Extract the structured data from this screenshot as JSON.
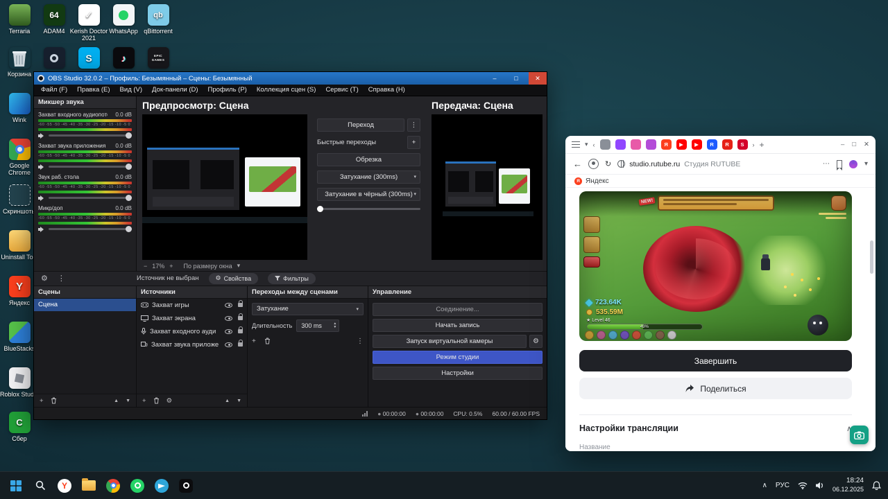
{
  "desktop": {
    "icons": [
      {
        "label": "Terraria",
        "glyph": ""
      },
      {
        "label": "ADAM4",
        "glyph": "64"
      },
      {
        "label": "Kerish Doctor 2021",
        "glyph": "✓"
      },
      {
        "label": "WhatsApp",
        "glyph": ""
      },
      {
        "label": "qBittorrent",
        "glyph": "qb"
      },
      {
        "label": "Корзина",
        "glyph": ""
      },
      {
        "label": "Steam",
        "glyph": ""
      },
      {
        "label": "Skype",
        "glyph": "S"
      },
      {
        "label": "TikTok",
        "glyph": "♪"
      },
      {
        "label": "Epic Games",
        "glyph": "EPIC GAMES"
      },
      {
        "label": "Wink",
        "glyph": ""
      },
      {
        "label": "Google Chrome",
        "glyph": ""
      },
      {
        "label": "Скриншоты",
        "glyph": ""
      },
      {
        "label": "Uninstall Tool",
        "glyph": ""
      },
      {
        "label": "Яндекс",
        "glyph": "Y"
      },
      {
        "label": "BlueStacks",
        "glyph": ""
      },
      {
        "label": "Roblox Studio",
        "glyph": ""
      },
      {
        "label": "Сбер",
        "glyph": "С"
      }
    ]
  },
  "obs": {
    "title": "OBS Studio 32.0.2 – Профиль: Безымянный – Сцены: Безымянный",
    "menu": [
      "Файл (F)",
      "Правка (E)",
      "Вид (V)",
      "Док-панели (D)",
      "Профиль (P)",
      "Коллекция сцен (S)",
      "Сервис (T)",
      "Справка (H)"
    ],
    "mixer": {
      "title": "Микшер звука",
      "scale": "-60 -55 -50 -45 -40 -35 -30 -25 -20 -15 -10 -5 0",
      "channels": [
        {
          "name": "Захват входного аудиопотока",
          "db": "0.0 dB"
        },
        {
          "name": "Захват звука приложения (БЕТА)",
          "db": "0.0 dB"
        },
        {
          "name": "Звук раб. стола",
          "db": "0.0 dB"
        },
        {
          "name": "Микр/доп",
          "db": "0.0 dB"
        }
      ]
    },
    "preview": {
      "label": "Предпросмотр: Сцена",
      "zoom": "17%",
      "fit": "По размеру окна"
    },
    "program": {
      "label": "Передача: Сцена"
    },
    "transitions_panel": {
      "main": "Переход",
      "quick": "Быстрые переходы",
      "options": [
        "Обрезка",
        "Затухание (300ms)",
        "Затухание в чёрный (300ms)"
      ]
    },
    "source_toolbar": {
      "no_source": "Источник не выбран",
      "properties": "Свойства",
      "filters": "Фильтры"
    },
    "scenes": {
      "title": "Сцены",
      "items": [
        "Сцена"
      ]
    },
    "sources": {
      "title": "Источники",
      "items": [
        "Захват игры",
        "Захват экрана",
        "Захват входного ауди",
        "Захват звука приложе"
      ]
    },
    "scene_transitions": {
      "title": "Переходы между сценами",
      "value": "Затухание",
      "duration_label": "Длительность",
      "duration": "300 ms"
    },
    "controls": {
      "title": "Управление",
      "stream": "Соединение...",
      "record": "Начать запись",
      "vcam": "Запуск виртуальной камеры",
      "studio": "Режим студии",
      "settings": "Настройки"
    },
    "status": {
      "rec": "00:00:00",
      "stream": "00:00:00",
      "cpu": "CPU: 0.5%",
      "fps": "60.00 / 60.00 FPS"
    }
  },
  "browser": {
    "tabs": {
      "favicons": [
        {
          "name": "speaker-site",
          "glyph": ""
        },
        {
          "name": "purple-site",
          "glyph": ""
        },
        {
          "name": "pink-site",
          "glyph": ""
        },
        {
          "name": "violet-site",
          "glyph": ""
        },
        {
          "name": "yandex",
          "glyph": "Я"
        },
        {
          "name": "youtube",
          "glyph": "▶"
        },
        {
          "name": "youtube",
          "glyph": "▶"
        },
        {
          "name": "rutube-blue",
          "glyph": "R"
        },
        {
          "name": "rutube-red",
          "glyph": "R"
        },
        {
          "name": "red-site",
          "glyph": "S"
        }
      ]
    },
    "url": "studio.rutube.ru",
    "page_title": "Студия RUTUBE",
    "bookmark": "Яндекс",
    "finish": "Завершить",
    "share": "Поделиться",
    "section": "Настройки трансляции",
    "field_label": "Название",
    "game": {
      "new_badge": "NEW!",
      "gems": "723.64K",
      "coins": "535.59M",
      "level": "★ Level 46",
      "progress": "49%"
    }
  },
  "taskbar": {
    "lang": "РУС",
    "time": "18:24",
    "date": "06.12.2025"
  },
  "icons": {
    "gear": "⚙",
    "dots_v": "⋮",
    "dots_h": "⋯",
    "chevron_down": "▾",
    "chevron_up": "∧",
    "plus": "+",
    "minus": "−",
    "up": "▲",
    "down": "▼",
    "close": "✕",
    "maximize": "□",
    "minimize": "–",
    "back": "←",
    "reload": "↻",
    "left": "‹",
    "right": "›",
    "record_dot": "●"
  },
  "colors": {
    "titlebar_blue": "#2676c8",
    "studio_mode_blue": "#3e56c6",
    "scene_selected": "#2b4f8f",
    "finish_black": "#202227",
    "capture_green": "#14a085",
    "yandex_red": "#fc3f1d"
  }
}
